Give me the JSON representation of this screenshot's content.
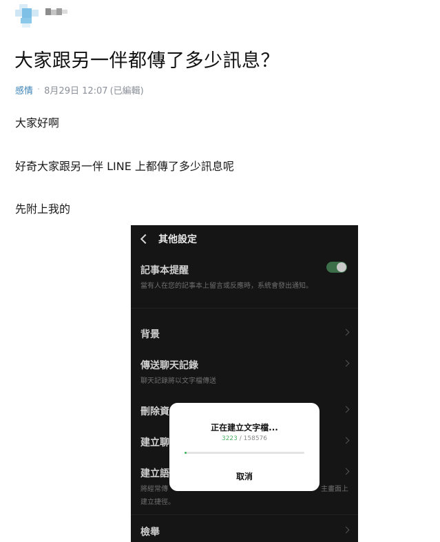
{
  "post": {
    "title": "大家跟另一伴都傳了多少訊息？",
    "board": "感情",
    "separator": "·",
    "date": "8月29日 12:07",
    "edited": "(已編輯)",
    "body": [
      "大家好啊",
      "好奇大家跟另一伴 LINE 上都傳了多少訊息呢",
      "先附上我的"
    ]
  },
  "screenshot": {
    "header_title": "其他設定",
    "items": [
      {
        "title": "記事本提醒",
        "subtitle": "當有人在您的記事本上留言或反應時，系統會發出通知。"
      },
      {
        "title": "背景",
        "subtitle": ""
      },
      {
        "title": "傳送聊天記錄",
        "subtitle": "聊天記錄將以文字檔傳送"
      },
      {
        "title": "刪除資",
        "subtitle": ""
      },
      {
        "title": "建立聊",
        "subtitle": ""
      },
      {
        "title": "建立語",
        "subtitle": "將經常傳",
        "subtitle_right": "主畫面上",
        "subtitle2": "建立捷徑。"
      },
      {
        "title": "檢舉",
        "subtitle": ""
      }
    ],
    "toggle_on": true,
    "dialog": {
      "title": "正在建立文字檔...",
      "current": "3223",
      "divider": " / ",
      "total": "158576",
      "progress_fraction": 0.02,
      "cancel": "取消"
    }
  },
  "colors": {
    "board_link": "#3b82b6",
    "meta_text": "#8a8f98",
    "screenshot_bg": "#151515",
    "progress_fill": "#3cb45a"
  }
}
